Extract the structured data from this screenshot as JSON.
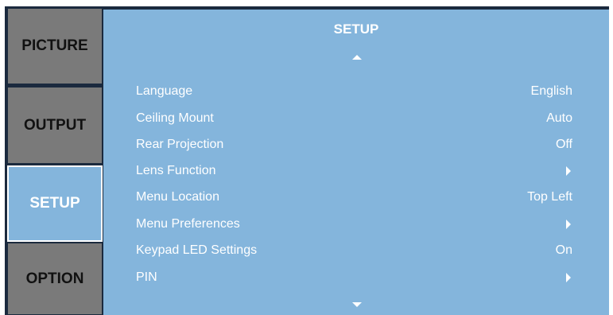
{
  "tabs": {
    "picture": "PICTURE",
    "output": "OUTPUT",
    "setup": "SETUP",
    "option": "OPTION"
  },
  "panel": {
    "title": "SETUP",
    "items": [
      {
        "label": "Language",
        "value": "English"
      },
      {
        "label": "Ceiling Mount",
        "value": "Auto"
      },
      {
        "label": "Rear Projection",
        "value": "Off"
      },
      {
        "label": "Lens Function",
        "value": "",
        "submenu_icon": "chevron-right-icon"
      },
      {
        "label": "Menu Location",
        "value": "Top Left"
      },
      {
        "label": "Menu Preferences",
        "value": "",
        "submenu_icon": "chevron-right-icon"
      },
      {
        "label": "Keypad LED Settings",
        "value": "On"
      },
      {
        "label": "PIN",
        "value": "",
        "submenu_icon": "chevron-right-icon"
      }
    ]
  },
  "colors": {
    "active_tab": "#84b5dc",
    "inactive_tab": "#7a7a7a",
    "frame": "#1b2a3e",
    "text": "#ffffff"
  }
}
